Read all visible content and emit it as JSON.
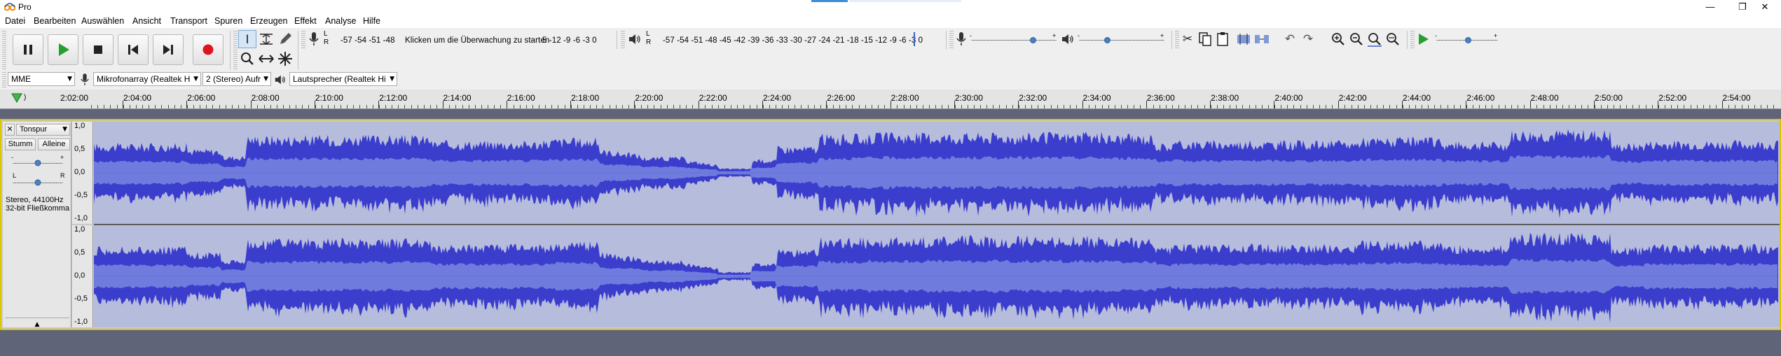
{
  "window": {
    "title": "Pro",
    "controls": {
      "minimize": "—",
      "maximize": "❐",
      "close": "✕"
    }
  },
  "menu": [
    "Datei",
    "Bearbeiten",
    "Auswählen",
    "Ansicht",
    "Transport",
    "Spuren",
    "Erzeugen",
    "Effekt",
    "Analyse",
    "Hilfe"
  ],
  "transport": {
    "pause": "pause-button",
    "play": "play-button",
    "stop": "stop-button",
    "skip_start": "skip-to-start-button",
    "skip_end": "skip-to-end-button",
    "record": "record-button"
  },
  "tools": [
    "selection-tool",
    "envelope-tool",
    "draw-tool",
    "zoom-tool",
    "timeshift-tool",
    "multi-tool"
  ],
  "recording_meter": {
    "lr": "L\nR",
    "scale": "-57 -54 -51 -48",
    "prompt": "Klicken um die Überwachung zu starten",
    "scale_tail": "5 -12 -9 -6 -3 0"
  },
  "playback_meter": {
    "lr": "L\nR",
    "scale": "-57 -54 -51 -48 -45 -42 -39 -36 -33 -30 -27 -24 -21 -18 -15 -12 -9 -6 -3 0"
  },
  "mixer": {
    "input_level": 0.72,
    "output_level": 0.31,
    "slider_minus": "-",
    "slider_plus": "+"
  },
  "play_at_speed": {
    "speed_level": 0.5,
    "minus": "-",
    "plus": "+"
  },
  "devices": {
    "host": "MME",
    "recording_device": "Mikrofonarray (Realtek H",
    "channels": "2 (Stereo) Aufr",
    "playback_device": "Lautsprecher (Realtek Hi"
  },
  "timeline": {
    "start_label": "2:02:00",
    "ticks": [
      "2:04:00",
      "2:06:00",
      "2:08:00",
      "2:10:00",
      "2:12:00",
      "2:14:00",
      "2:16:00",
      "2:18:00",
      "2:20:00",
      "2:22:00",
      "2:24:00",
      "2:26:00",
      "2:28:00",
      "2:30:00",
      "2:32:00",
      "2:34:00",
      "2:36:00",
      "2:38:00",
      "2:40:00",
      "2:42:00",
      "2:44:00",
      "2:46:00",
      "2:48:00",
      "2:50:00",
      "2:52:00",
      "2:54:00"
    ]
  },
  "track": {
    "name": "Tonspur",
    "mute": "Stumm",
    "solo": "Alleine",
    "gain_minus": "-",
    "gain_plus": "+",
    "pan_left": "L",
    "pan_right": "R",
    "format": "Stereo, 44100Hz",
    "bitdepth": "32-bit Fließkomma",
    "close": "✕",
    "menu_arrow": "▼",
    "collapse": "▲",
    "y_scale": [
      "1,0",
      "0,5",
      "0,0",
      "-0,5",
      "-1,0"
    ]
  },
  "colors": {
    "waveform": "#3b3dcc",
    "waveform_rms": "#6f7cde",
    "waveform_bg": "#b6bcdc",
    "selection_border": "#d9c600",
    "background": "#5f6479"
  }
}
